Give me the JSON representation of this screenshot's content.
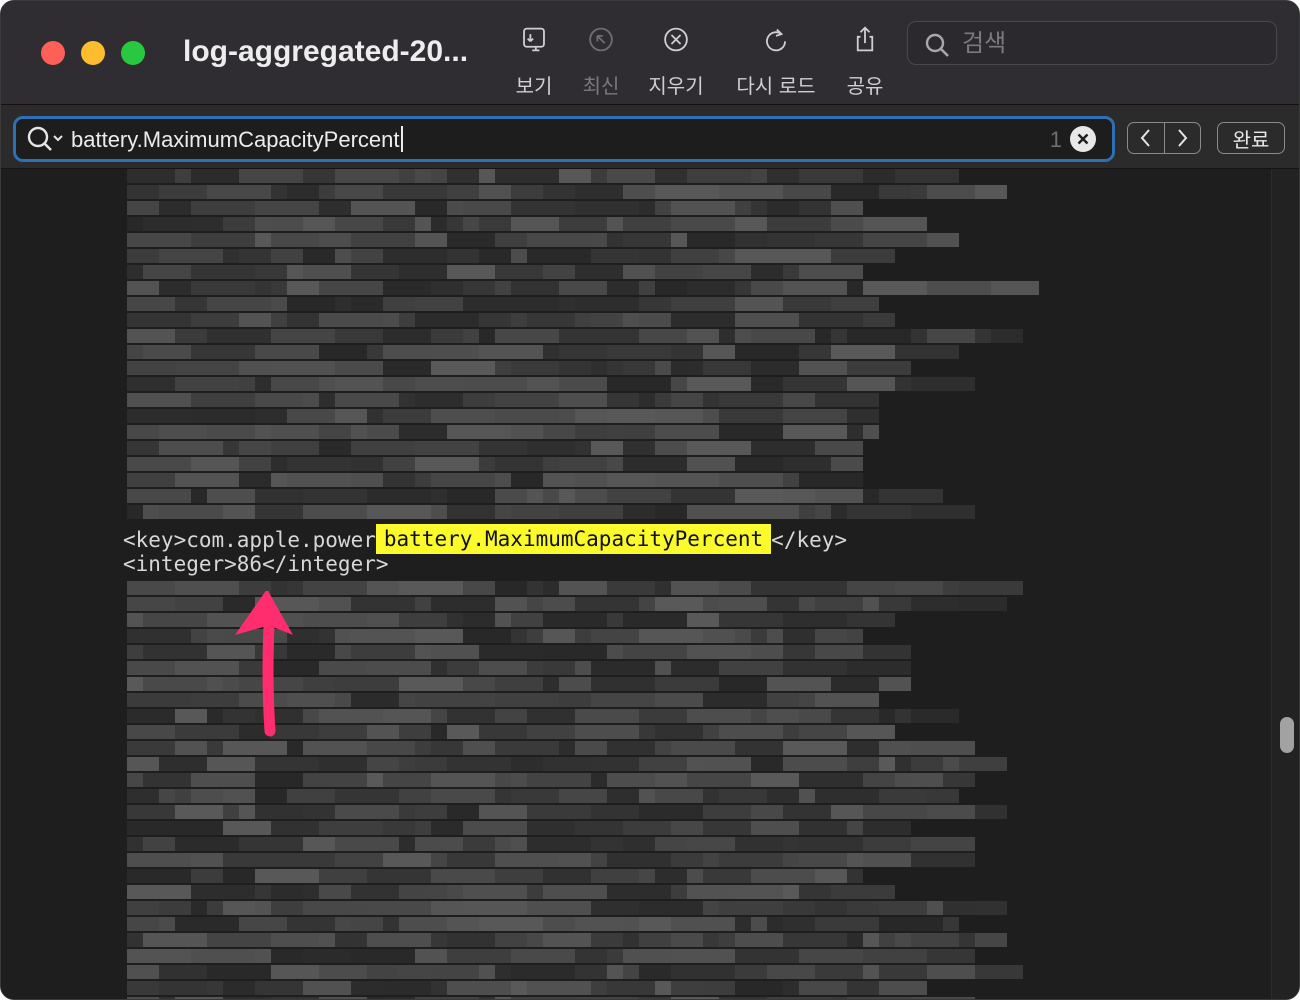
{
  "window": {
    "title": "log-aggregated-20..."
  },
  "toolbar": {
    "items": [
      {
        "label": "보기",
        "icon": "sidebar-view-icon",
        "enabled": true
      },
      {
        "label": "최신",
        "icon": "jump-to-latest-icon",
        "enabled": false
      },
      {
        "label": "지우기",
        "icon": "clear-circle-x-icon",
        "enabled": true
      },
      {
        "label": "다시 로드",
        "icon": "reload-icon",
        "enabled": true
      },
      {
        "label": "공유",
        "icon": "share-icon",
        "enabled": true
      }
    ],
    "search": {
      "placeholder": "검색",
      "icon": "search-icon"
    }
  },
  "find_bar": {
    "query": "battery.MaximumCapacityPercent",
    "match_count": "1",
    "done_label": "완료"
  },
  "content": {
    "line1": {
      "prefix": "<key>com.apple.power",
      "match": "battery.MaximumCapacityPercent",
      "suffix": "</key>"
    },
    "line2": "<integer>86</integer>"
  },
  "colors": {
    "highlight": "#fbfa2a",
    "find_focus": "#2f6fb4",
    "arrow": "#ff2d6e"
  }
}
